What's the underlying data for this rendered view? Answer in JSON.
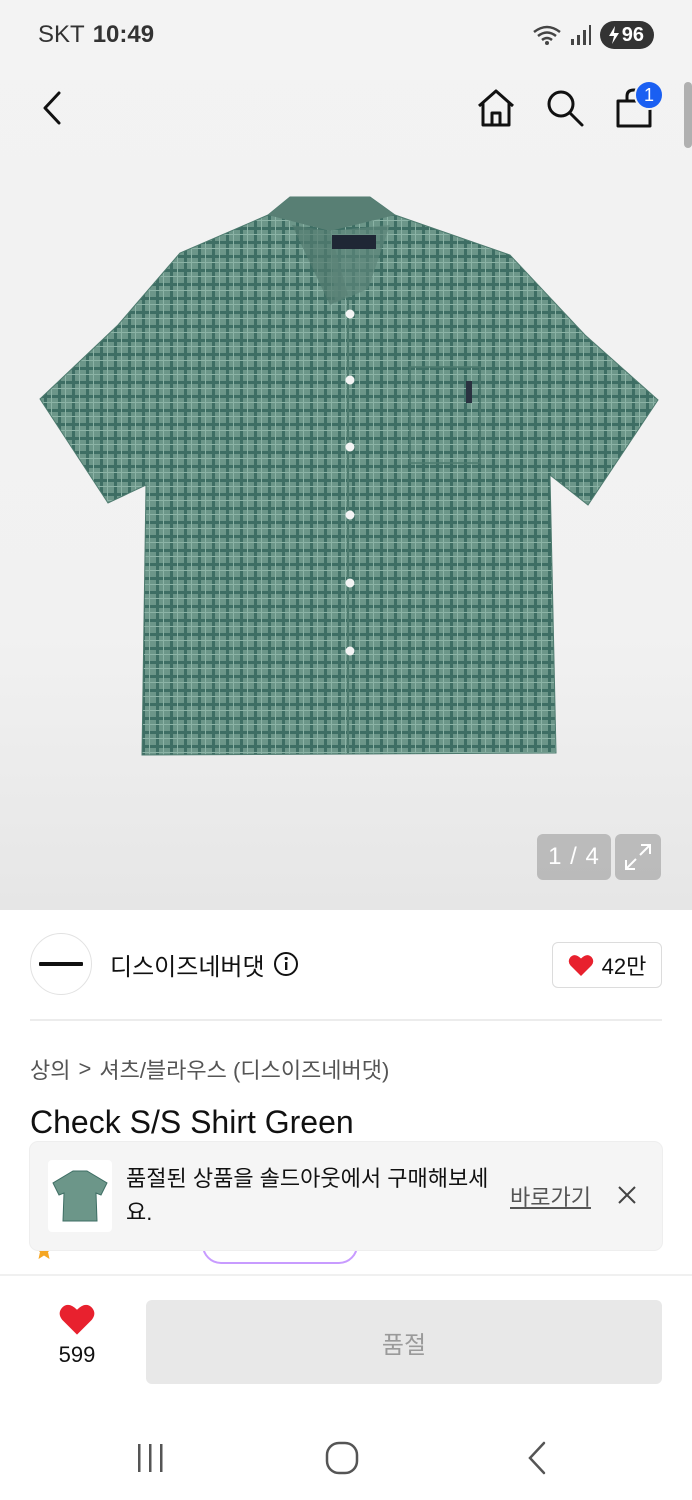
{
  "status_bar": {
    "carrier": "SKT",
    "time": "10:49",
    "battery": "96",
    "icons": [
      "wifi-icon",
      "signal-icon",
      "battery-charging-icon"
    ]
  },
  "nav": {
    "icons": [
      "back-arrow-icon",
      "home-icon",
      "search-icon",
      "shopping-bag-icon"
    ],
    "cart_count": "1"
  },
  "gallery": {
    "counter": "1 / 4",
    "image_alt": "green check short sleeve shirt",
    "icon": "expand-icon"
  },
  "brand": {
    "logo_text": "thisisneverthat",
    "name": "디스이즈네버댓",
    "likes": "42만",
    "icons": [
      "info-icon",
      "heart-icon"
    ],
    "heart_color": "#e8212e"
  },
  "breadcrumb": {
    "level1": "상의",
    "separator": ">",
    "level2": "셔츠/블라우스 (디스이즈네버댓)"
  },
  "product": {
    "title": "Check S/S Shirt Green"
  },
  "toast": {
    "message": "품절된 상품을 솔드아웃에서 구매해보세요.",
    "link": "바로가기",
    "icons": [
      "close-icon"
    ]
  },
  "bottom_bar": {
    "wish_count": "599",
    "soldout_label": "품절",
    "accent_color": "#e8212e"
  },
  "android_nav": {
    "icons": [
      "recent-apps-icon",
      "home-circle-icon",
      "back-chevron-icon"
    ]
  }
}
